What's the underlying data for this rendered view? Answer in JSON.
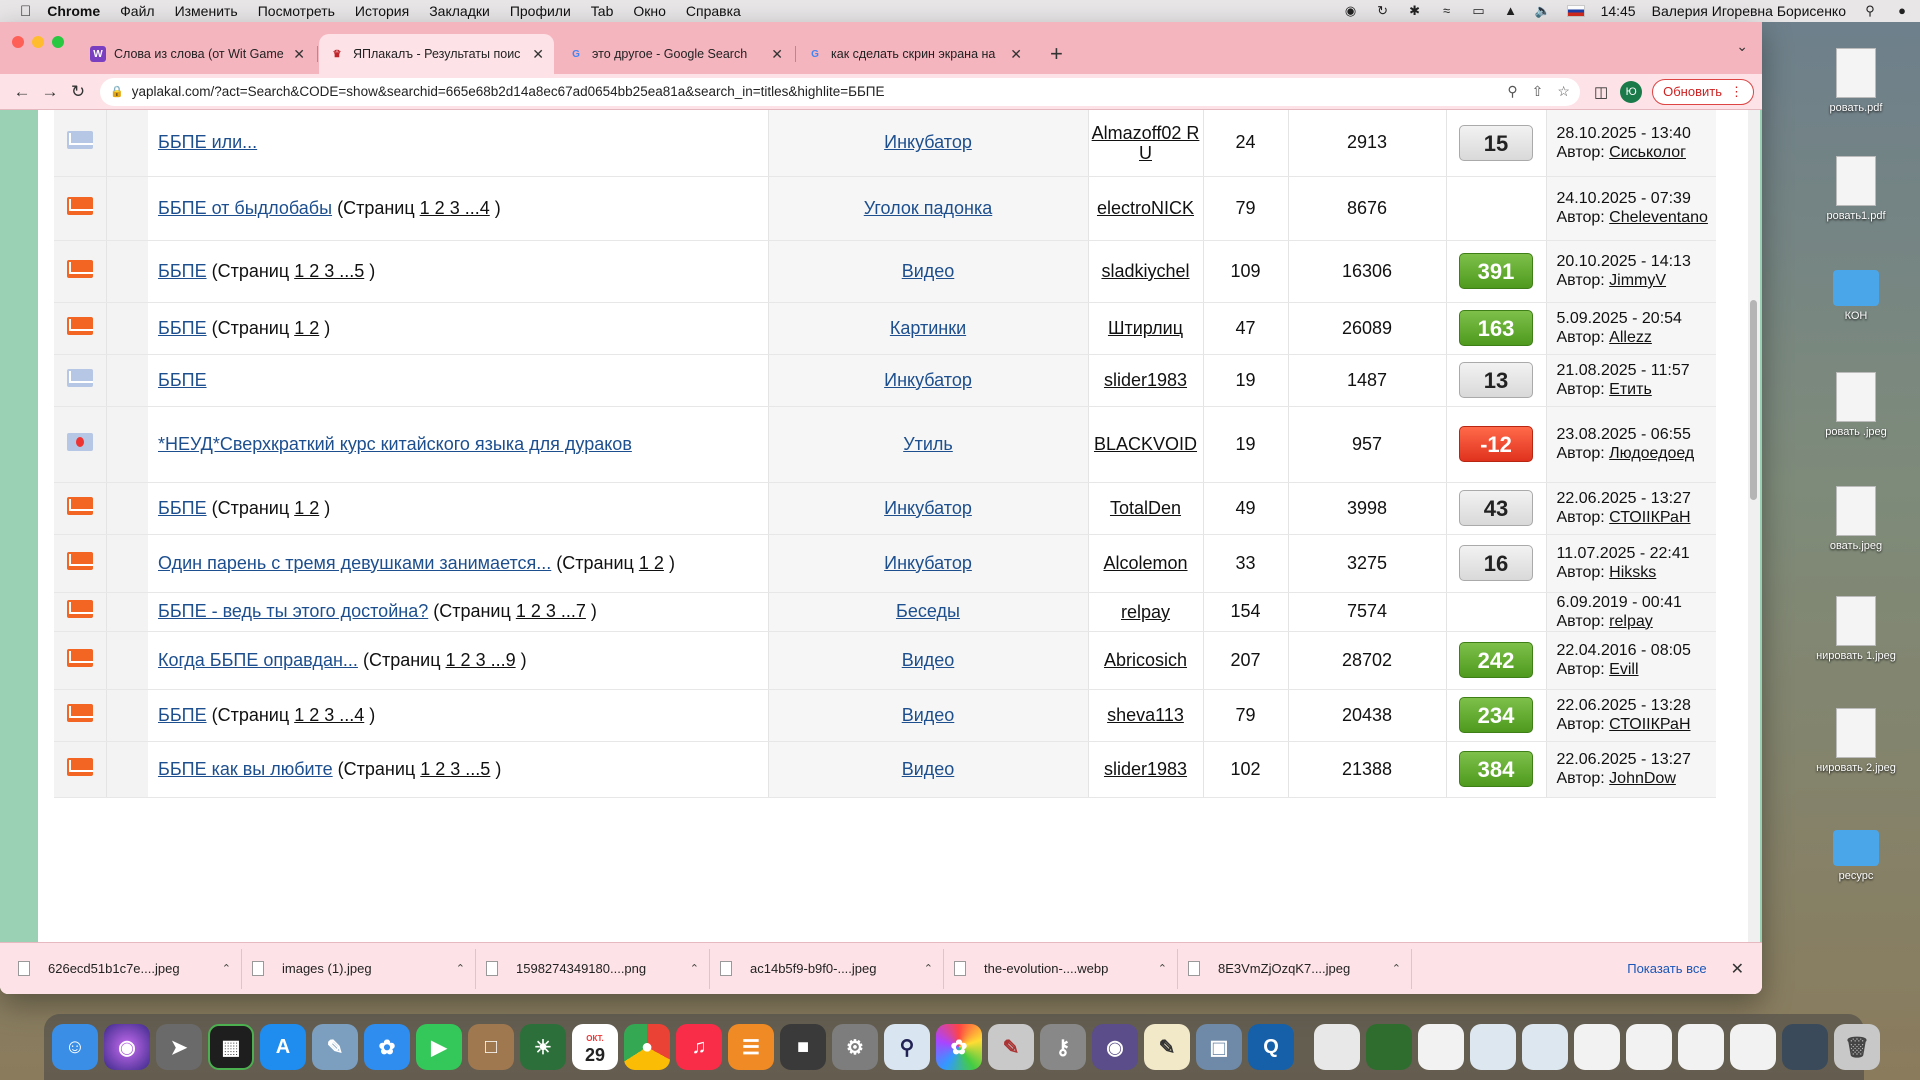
{
  "menubar": {
    "app": "Chrome",
    "items": [
      "Файл",
      "Изменить",
      "Посмотреть",
      "История",
      "Закладки",
      "Профили",
      "Tab",
      "Окно",
      "Справка"
    ],
    "time": "14:45",
    "user": "Валерия Игоревна Борисенко"
  },
  "tabs": [
    {
      "title": "Слова из слова (от Wit Game",
      "active": false
    },
    {
      "title": "ЯПлакалъ - Результаты поис",
      "active": true
    },
    {
      "title": "это другое - Google Search",
      "active": false
    },
    {
      "title": "как сделать скрин экрана на",
      "active": false
    }
  ],
  "toolbar": {
    "url": "yaplakal.com/?act=Search&CODE=show&searchid=665e68b2d14a8ec67ad0654bb25ea81a&search_in=titles&highlite=ББПЕ",
    "update_label": "Обновить",
    "profile_initial": "Ю"
  },
  "rows": [
    {
      "icon": "cold",
      "title": "ББПЕ или...",
      "pages": "",
      "forum": "Инкубатор",
      "author": "Almazoff02 RU",
      "replies": "24",
      "views": "2913",
      "rating": "15",
      "rating_kind": "neutral",
      "date": "28.10.2025 - 13:40",
      "author_label": "Автор:",
      "last_author": "Сиськолог"
    },
    {
      "icon": "hot",
      "title": "ББПЕ от быдлобабы",
      "pages": "1 2 3 ...4",
      "forum": "Уголок падонка",
      "author": "electroNICK",
      "replies": "79",
      "views": "8676",
      "rating": "",
      "rating_kind": "",
      "date": "24.10.2025 - 07:39",
      "author_label": "Автор:",
      "last_author": "Cheleventano"
    },
    {
      "icon": "hot",
      "title": "ББПЕ",
      "pages": "1 2 3 ...5",
      "forum": "Видео",
      "author": "sladkiychel",
      "replies": "109",
      "views": "16306",
      "rating": "391",
      "rating_kind": "pos",
      "date": "20.10.2025 - 14:13",
      "author_label": "Автор:",
      "last_author": "JimmyV"
    },
    {
      "icon": "hot",
      "title": "ББПЕ",
      "pages": "1 2",
      "forum": "Картинки",
      "author": "Штирлиц",
      "replies": "47",
      "views": "26089",
      "rating": "163",
      "rating_kind": "pos",
      "date": "5.09.2025 - 20:54",
      "author_label": "Автор:",
      "last_author": "Allezz"
    },
    {
      "icon": "cold",
      "title": "ББПЕ",
      "pages": "",
      "forum": "Инкубатор",
      "author": "slider1983",
      "replies": "19",
      "views": "1487",
      "rating": "13",
      "rating_kind": "neutral",
      "date": "21.08.2025 - 11:57",
      "author_label": "Автор:",
      "last_author": "Етить"
    },
    {
      "icon": "poll",
      "title": "*НЕУД*Сверхкраткий курс китайского языка для дураков",
      "pages": "",
      "forum": "Утиль",
      "author": "BLACKVOID",
      "replies": "19",
      "views": "957",
      "rating": "-12",
      "rating_kind": "neg",
      "date": "23.08.2025 - 06:55",
      "author_label": "Автор:",
      "last_author": "Людоедоед"
    },
    {
      "icon": "hot",
      "title": "ББПЕ",
      "pages": "1 2",
      "forum": "Инкубатор",
      "author": "TotalDen",
      "replies": "49",
      "views": "3998",
      "rating": "43",
      "rating_kind": "neutral",
      "date": "22.06.2025 - 13:27",
      "author_label": "Автор:",
      "last_author": "СТОIIКРаН"
    },
    {
      "icon": "hot",
      "title": "Один парень с тремя девушками занимается...",
      "pages": "1 2",
      "forum": "Инкубатор",
      "author": "Alcolemon",
      "replies": "33",
      "views": "3275",
      "rating": "16",
      "rating_kind": "neutral",
      "date": "11.07.2025 - 22:41",
      "author_label": "Автор:",
      "last_author": "Hiksks"
    },
    {
      "icon": "hot",
      "title": "ББПЕ - ведь ты этого достойна?",
      "pages": "1 2 3 ...7",
      "forum": "Беседы",
      "author": "relpay",
      "replies": "154",
      "views": "7574",
      "rating": "",
      "rating_kind": "",
      "date": "6.09.2019 - 00:41",
      "author_label": "Автор:",
      "last_author": "relpay"
    },
    {
      "icon": "hot",
      "title": "Когда ББПЕ оправдан...",
      "pages": "1 2 3 ...9",
      "forum": "Видео",
      "author": "Abricosich",
      "replies": "207",
      "views": "28702",
      "rating": "242",
      "rating_kind": "pos",
      "date": "22.04.2016 - 08:05",
      "author_label": "Автор:",
      "last_author": "Evill"
    },
    {
      "icon": "hot",
      "title": "ББПЕ",
      "pages": "1 2 3 ...4",
      "forum": "Видео",
      "author": "sheva113",
      "replies": "79",
      "views": "20438",
      "rating": "234",
      "rating_kind": "pos",
      "date": "22.06.2025 - 13:28",
      "author_label": "Автор:",
      "last_author": "СТОIIКРаН"
    },
    {
      "icon": "hot",
      "title": "ББПЕ как вы любите",
      "pages": "1 2 3 ...5",
      "forum": "Видео",
      "author": "slider1983",
      "replies": "102",
      "views": "21388",
      "rating": "384",
      "rating_kind": "pos",
      "date": "22.06.2025 - 13:27",
      "author_label": "Автор:",
      "last_author": "JohnDow"
    }
  ],
  "pages_prefix": "(Страниц",
  "pages_suffix": ")",
  "downloads": {
    "files": [
      "626ecd51b1c7e....jpeg",
      "images (1).jpeg",
      "1598274349180....png",
      "ac14b5f9-b9f0-....jpeg",
      "the-evolution-....webp",
      "8E3VmZjOzqK7....jpeg"
    ],
    "show_all": "Показать все"
  },
  "desktop": {
    "items": [
      "ровать.pdf",
      "ровать1.pdf",
      "КОН",
      "ровать .jpeg",
      "овать.jpeg",
      "нировать 1.jpeg",
      "нировать 2.jpeg",
      "ресурс"
    ]
  },
  "dock": {
    "calendar_day": "29",
    "calendar_month": "ОКТ."
  },
  "colors": {
    "tabstrip": "#f5b5bf",
    "toolbar": "#fde3e7",
    "link": "#1d4f8e",
    "rating_positive": "#4e9a1e",
    "rating_negative": "#e0321e",
    "page_side": "#9ad1b4"
  }
}
